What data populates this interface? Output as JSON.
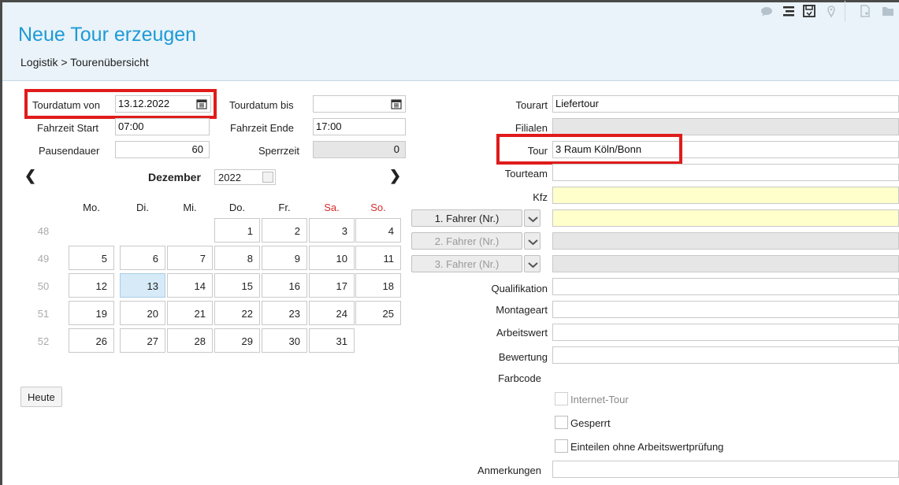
{
  "header": {
    "title": "Neue Tour erzeugen",
    "breadcrumb": "Logistik > Tourenübersicht"
  },
  "toolbar": [
    "comment-icon",
    "list-icon",
    "save-icon",
    "location-icon",
    "new-document-icon",
    "folder-icon"
  ],
  "form_left": {
    "tourdatum_von_label": "Tourdatum von",
    "tourdatum_von_value": "13.12.2022",
    "tourdatum_bis_label": "Tourdatum bis",
    "tourdatum_bis_value": "",
    "fahrzeit_start_label": "Fahrzeit Start",
    "fahrzeit_start_value": "07:00",
    "fahrzeit_ende_label": "Fahrzeit Ende",
    "fahrzeit_ende_value": "17:00",
    "pausendauer_label": "Pausendauer",
    "pausendauer_value": "60",
    "sperrzeit_label": "Sperrzeit",
    "sperrzeit_value": "0"
  },
  "calendar": {
    "month": "Dezember",
    "year": "2022",
    "weekdays": [
      "Mo.",
      "Di.",
      "Mi.",
      "Do.",
      "Fr.",
      "Sa.",
      "So."
    ],
    "weeks": [
      {
        "week": "48",
        "days": [
          "",
          "",
          "",
          "1",
          "2",
          "3",
          "4"
        ]
      },
      {
        "week": "49",
        "days": [
          "5",
          "6",
          "7",
          "8",
          "9",
          "10",
          "11"
        ]
      },
      {
        "week": "50",
        "days": [
          "12",
          "13",
          "14",
          "15",
          "16",
          "17",
          "18"
        ]
      },
      {
        "week": "51",
        "days": [
          "19",
          "20",
          "21",
          "22",
          "23",
          "24",
          "25"
        ]
      },
      {
        "week": "52",
        "days": [
          "26",
          "27",
          "28",
          "29",
          "30",
          "31",
          ""
        ]
      }
    ],
    "selected_day": "13",
    "today_button": "Heute"
  },
  "form_right": {
    "tourart_label": "Tourart",
    "tourart_value": "Liefertour",
    "filialen_label": "Filialen",
    "tour_label": "Tour",
    "tour_value": "3  Raum Köln/Bonn",
    "tourteam_label": "Tourteam",
    "kfz_label": "Kfz",
    "fahrer1_label": "1. Fahrer (Nr.)",
    "fahrer2_label": "2. Fahrer (Nr.)",
    "fahrer3_label": "3. Fahrer (Nr.)",
    "qualifikation_label": "Qualifikation",
    "montageart_label": "Montageart",
    "arbeitswert_label": "Arbeitswert",
    "bewertung_label": "Bewertung",
    "farbcode_label": "Farbcode",
    "internet_tour_label": "Internet-Tour",
    "gesperrt_label": "Gesperrt",
    "einteilen_label": "Einteilen ohne Arbeitswertprüfung",
    "anmerkungen_label": "Anmerkungen"
  },
  "colors": {
    "accent": "#1d9ad6",
    "highlight": "#e01b1b",
    "selected_day_bg": "#d6eaf8",
    "required_field_bg": "#ffffcc"
  }
}
